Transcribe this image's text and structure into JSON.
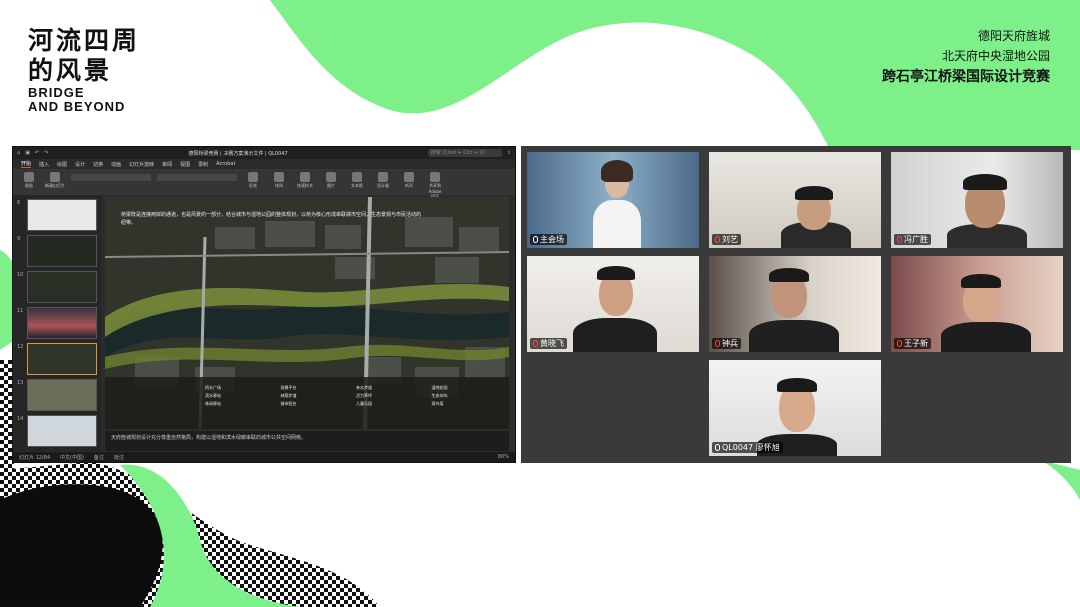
{
  "brand": {
    "title_line1": "河流四周",
    "title_line2": "的风景",
    "subtitle_line1": "BRIDGE",
    "subtitle_line2": "AND BEYOND"
  },
  "event": {
    "line1": "德阳天府旌城",
    "line2": "北天府中央湿地公园",
    "line3": "跨石亭江桥梁国际设计竞赛"
  },
  "colors": {
    "accent_green": "#7ef08a",
    "dark": "#111111"
  },
  "powerpoint": {
    "doc_title": "德阳桥梁竞赛 | 决赛方案演示文件 | QL0047",
    "search_placeholder": "搜索 (Cmd + Ctrl + U)",
    "tabs": [
      "开始",
      "插入",
      "绘图",
      "设计",
      "切换",
      "动画",
      "幻灯片放映",
      "审阅",
      "视图",
      "录制",
      "Acrobat"
    ],
    "active_tab": "开始",
    "ribbon_buttons": [
      "粘贴",
      "新建幻灯片",
      "形状",
      "排列",
      "快速样式",
      "图片",
      "文本框",
      "设计器",
      "听写",
      "共享到Adobe PDF"
    ],
    "slide_numbers": [
      "8",
      "9",
      "10",
      "11",
      "12",
      "13",
      "14"
    ],
    "current_slide": "12",
    "slide_intro": "桥梁既是连接两岸的通道，也是风景的一部分，结合城市与湿地公园的整体规划，以桥为核心形成串联城市空间、生态景观与市民活动的纽带。",
    "legend": [
      "桥头广场",
      "观景平台",
      "亲水步道",
      "湿地花园",
      "滨水驿站",
      "林荫步道",
      "活力草坪",
      "生态岛屿",
      "休闲驿站",
      "城市阳台",
      "儿童乐园",
      "观鸟塔"
    ],
    "notes": "天府旌城规划设计充分尊重自然格局，构建以湿地和滨水绿廊串联的城市公共空间网络。",
    "status_slide": "幻灯片 12/84",
    "status_lang": "中文(中国)",
    "status_zoom": "80%",
    "status_notes": "备注",
    "status_comments": "批注"
  },
  "participants": [
    {
      "name": "主会场",
      "mic": "on"
    },
    {
      "name": "刘艺",
      "mic": "off"
    },
    {
      "name": "冯广胜",
      "mic": "off"
    },
    {
      "name": "黄晓飞",
      "mic": "off"
    },
    {
      "name": "钟兵",
      "mic": "off"
    },
    {
      "name": "王子新",
      "mic": "off"
    },
    {
      "name": "QL0047 廖怀旭",
      "mic": "on"
    }
  ]
}
